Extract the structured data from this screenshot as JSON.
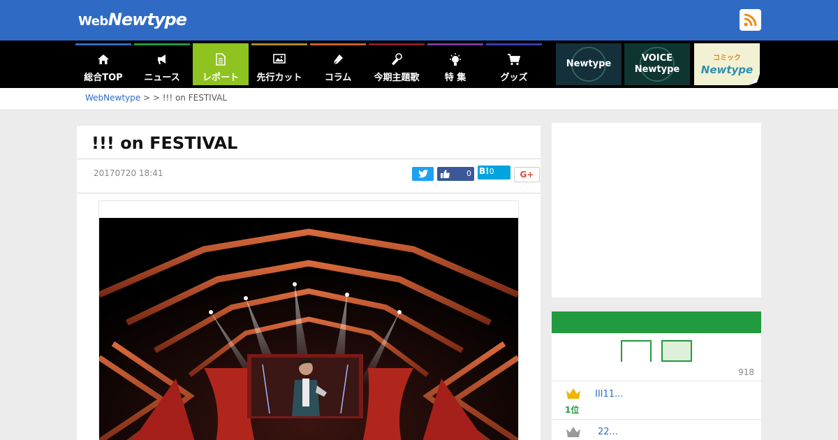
{
  "header": {
    "logo_web": "Web",
    "logo_newtype": "Newtype"
  },
  "nav": {
    "items": [
      {
        "label": "総合TOP",
        "icon": "home-icon",
        "color": "#2f6bc5"
      },
      {
        "label": "ニュース",
        "icon": "megaphone-icon",
        "color": "#229a3f"
      },
      {
        "label": "レポート",
        "icon": "document-icon",
        "color": "#8fc31f",
        "active": true
      },
      {
        "label": "先行カット",
        "icon": "image-icon",
        "color": "#a88a1f"
      },
      {
        "label": "コラム",
        "icon": "pen-icon",
        "color": "#c8611f"
      },
      {
        "label": "今期主題歌",
        "icon": "microphone-icon",
        "color": "#8a1c2a"
      },
      {
        "label": "特 集",
        "icon": "lightbulb-icon",
        "color": "#7a3aa0"
      },
      {
        "label": "グッズ",
        "icon": "cart-icon",
        "color": "#3a3ab0"
      }
    ],
    "banners": [
      {
        "line1": "Newtype",
        "line2": ""
      },
      {
        "line1": "VOICE",
        "line2": "Newtype"
      },
      {
        "line1": "コミック",
        "line2": "Newtype"
      }
    ]
  },
  "breadcrumb": {
    "home": "WebNewtype",
    "sep1": " > ",
    "sep2": " > ",
    "current": "!!! on FESTIVAL"
  },
  "article": {
    "title": "!!! on FESTIVAL",
    "date": "20170720 18:41",
    "like_count": "0",
    "hatena_label": "B!",
    "hatena_count": "0",
    "gplus_label": "G+"
  },
  "ranking": {
    "count": "918",
    "items": [
      {
        "rank": "1位",
        "title": "III11..."
      },
      {
        "rank": "",
        "title": "22..."
      }
    ]
  },
  "colors": {
    "brand_blue": "#2f6bc5",
    "ranking_green": "#229a3f",
    "active_tab": "#8fc31f"
  }
}
